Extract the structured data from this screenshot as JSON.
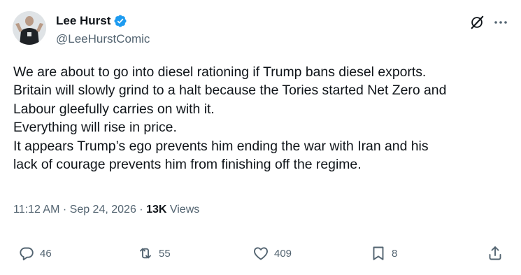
{
  "author": {
    "display_name": "Lee Hurst",
    "handle": "@LeeHurstComic",
    "verified": true,
    "verified_color": "#1d9bf0"
  },
  "header_icons": [
    "grok-icon",
    "more-icon"
  ],
  "tweet": {
    "lines": [
      "We are about to go into diesel rationing if Trump bans diesel exports.",
      "Britain will slowly grind to a halt because the Tories started Net Zero and",
      "Labour gleefully carries on with it.",
      "Everything will rise in price.",
      "It appears Trump’s ego prevents him ending the war with Iran and his",
      "lack of courage prevents him from finishing off the regime."
    ]
  },
  "meta": {
    "time": "11:12 AM",
    "separator1": " · ",
    "date": "Sep 24, 2026",
    "separator2": " · ",
    "views_count": "13K",
    "views_label": " Views"
  },
  "actions": {
    "reply_count": "46",
    "retweet_count": "55",
    "like_count": "409",
    "bookmark_count": "8"
  },
  "colors": {
    "text_primary": "#0f1419",
    "text_secondary": "#536471",
    "accent": "#1d9bf0"
  }
}
